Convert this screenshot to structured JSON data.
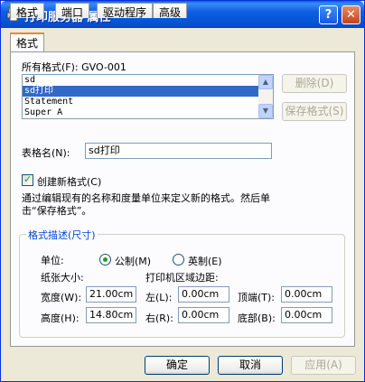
{
  "window": {
    "title": "打印服务器 属性",
    "help_glyph": "?",
    "close_glyph": "✕"
  },
  "tabs": [
    {
      "label": "格式",
      "active": true
    },
    {
      "label": "端口",
      "active": false
    },
    {
      "label": "驱动程序",
      "active": false
    },
    {
      "label": "高级",
      "active": false
    }
  ],
  "forms": {
    "all_formats_label": "所有格式(F):",
    "server_name": "GVO-001",
    "items": [
      "sd",
      "sd打印",
      "Statement",
      "Super A"
    ],
    "selected_index": 1,
    "delete_button": "删除(D)",
    "save_button": "保存格式(S)",
    "scroll_up": "▲",
    "scroll_down": "▼"
  },
  "form_name": {
    "label": "表格名(N):",
    "value": "sd打印"
  },
  "create_new": {
    "label": "创建新格式(C)",
    "checked": true,
    "check_glyph": "✓"
  },
  "description": "通过编辑现有的名称和度量单位来定义新的格式。然后单击“保存格式”。",
  "format_desc": {
    "title": "格式描述(尺寸)",
    "units_label": "单位:",
    "metric_label": "公制(M)",
    "english_label": "英制(E)",
    "paper_size_label": "纸张大小:",
    "margins_label": "打印机区域边距:",
    "width_label": "宽度(W):",
    "width_value": "21.00cm",
    "height_label": "高度(H):",
    "height_value": "14.80cm",
    "left_label": "左(L):",
    "left_value": "0.00cm",
    "right_label": "右(R):",
    "right_value": "0.00cm",
    "top_label": "顶端(T):",
    "top_value": "0.00cm",
    "bottom_label": "底部(B):",
    "bottom_value": "0.00cm"
  },
  "buttons": {
    "ok": "确定",
    "cancel": "取消",
    "apply": "应用(A)"
  }
}
